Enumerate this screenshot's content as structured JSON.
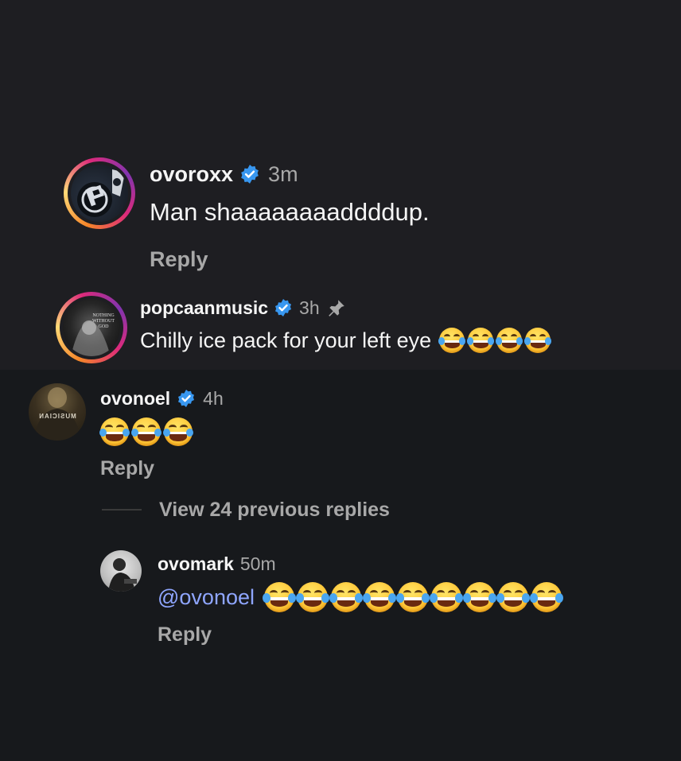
{
  "comments": [
    {
      "username": "ovoroxx",
      "verified": true,
      "time": "3m",
      "text": "Man shaaaaaaaaddddup.",
      "reply_label": "Reply"
    },
    {
      "username": "popcaanmusic",
      "verified": true,
      "time": "3h",
      "pinned": true,
      "text": "Chilly ice pack for your left eye",
      "emoji_count": 4,
      "avatar_text": "NOTHING WITHOUT GOD"
    },
    {
      "username": "ovonoel",
      "verified": true,
      "time": "4h",
      "emoji_count": 3,
      "reply_label": "Reply",
      "avatar_text": "MUSICIAN"
    }
  ],
  "view_replies": "View 24 previous replies",
  "reply": {
    "username": "ovomark",
    "time": "50m",
    "mention": "@ovonoel",
    "emoji_count": 9,
    "reply_label": "Reply"
  },
  "icons": {
    "verified": "verified-badge-icon",
    "pin": "pin-icon",
    "emoji": "face-with-tears-of-joy-icon"
  },
  "colors": {
    "verified": "#3897f0",
    "mention": "#8fa6ff",
    "secondary_text": "#a8a8a8"
  }
}
